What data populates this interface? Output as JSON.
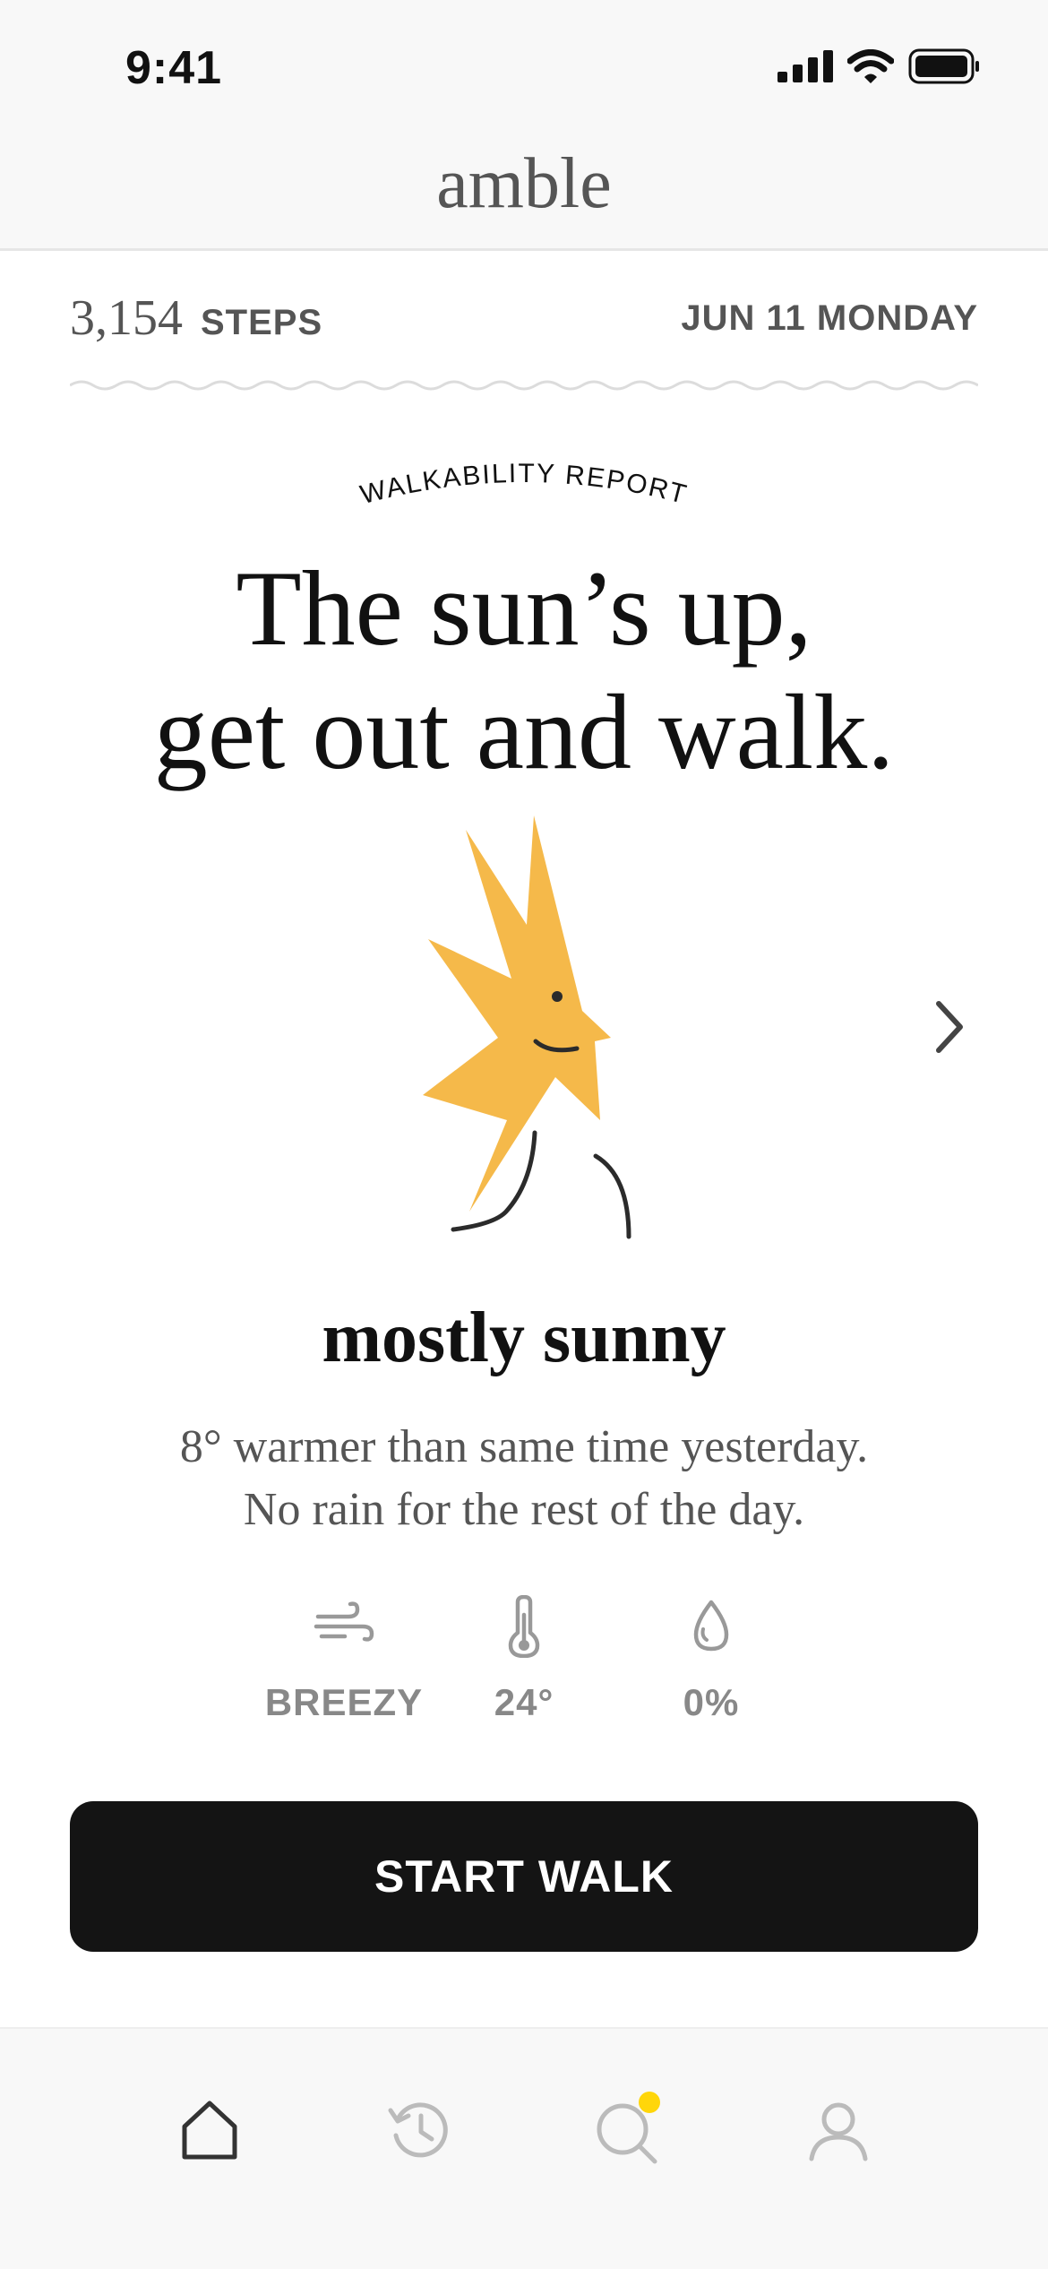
{
  "status_bar": {
    "time": "9:41"
  },
  "header": {
    "brand": "amble"
  },
  "steps": {
    "count": "3,154",
    "label": "STEPS"
  },
  "date": "JUN 11 MONDAY",
  "report": {
    "eyebrow": "WALKABILITY REPORT",
    "headline_line1": "The sun’s up,",
    "headline_line2": "get out and walk.",
    "condition": "mostly sunny",
    "desc_line1": "8° warmer than same time yesterday.",
    "desc_line2": "No rain for the rest of the day."
  },
  "stats": {
    "wind": {
      "value": "BREEZY",
      "icon": "wind-icon"
    },
    "temperature": {
      "value": "24°",
      "icon": "thermometer-icon"
    },
    "precipitation": {
      "value": "0%",
      "icon": "raindrop-icon"
    }
  },
  "cta": {
    "label": "START WALK"
  },
  "tabs": [
    {
      "icon": "home-icon",
      "active": true
    },
    {
      "icon": "history-icon",
      "active": false
    },
    {
      "icon": "search-icon",
      "active": false,
      "badge": true
    },
    {
      "icon": "profile-icon",
      "active": false
    }
  ],
  "colors": {
    "sun": "#F5B94A",
    "badge": "#FFD60A",
    "button": "#141414",
    "muted_text": "#555555",
    "stat_text": "#888888"
  }
}
